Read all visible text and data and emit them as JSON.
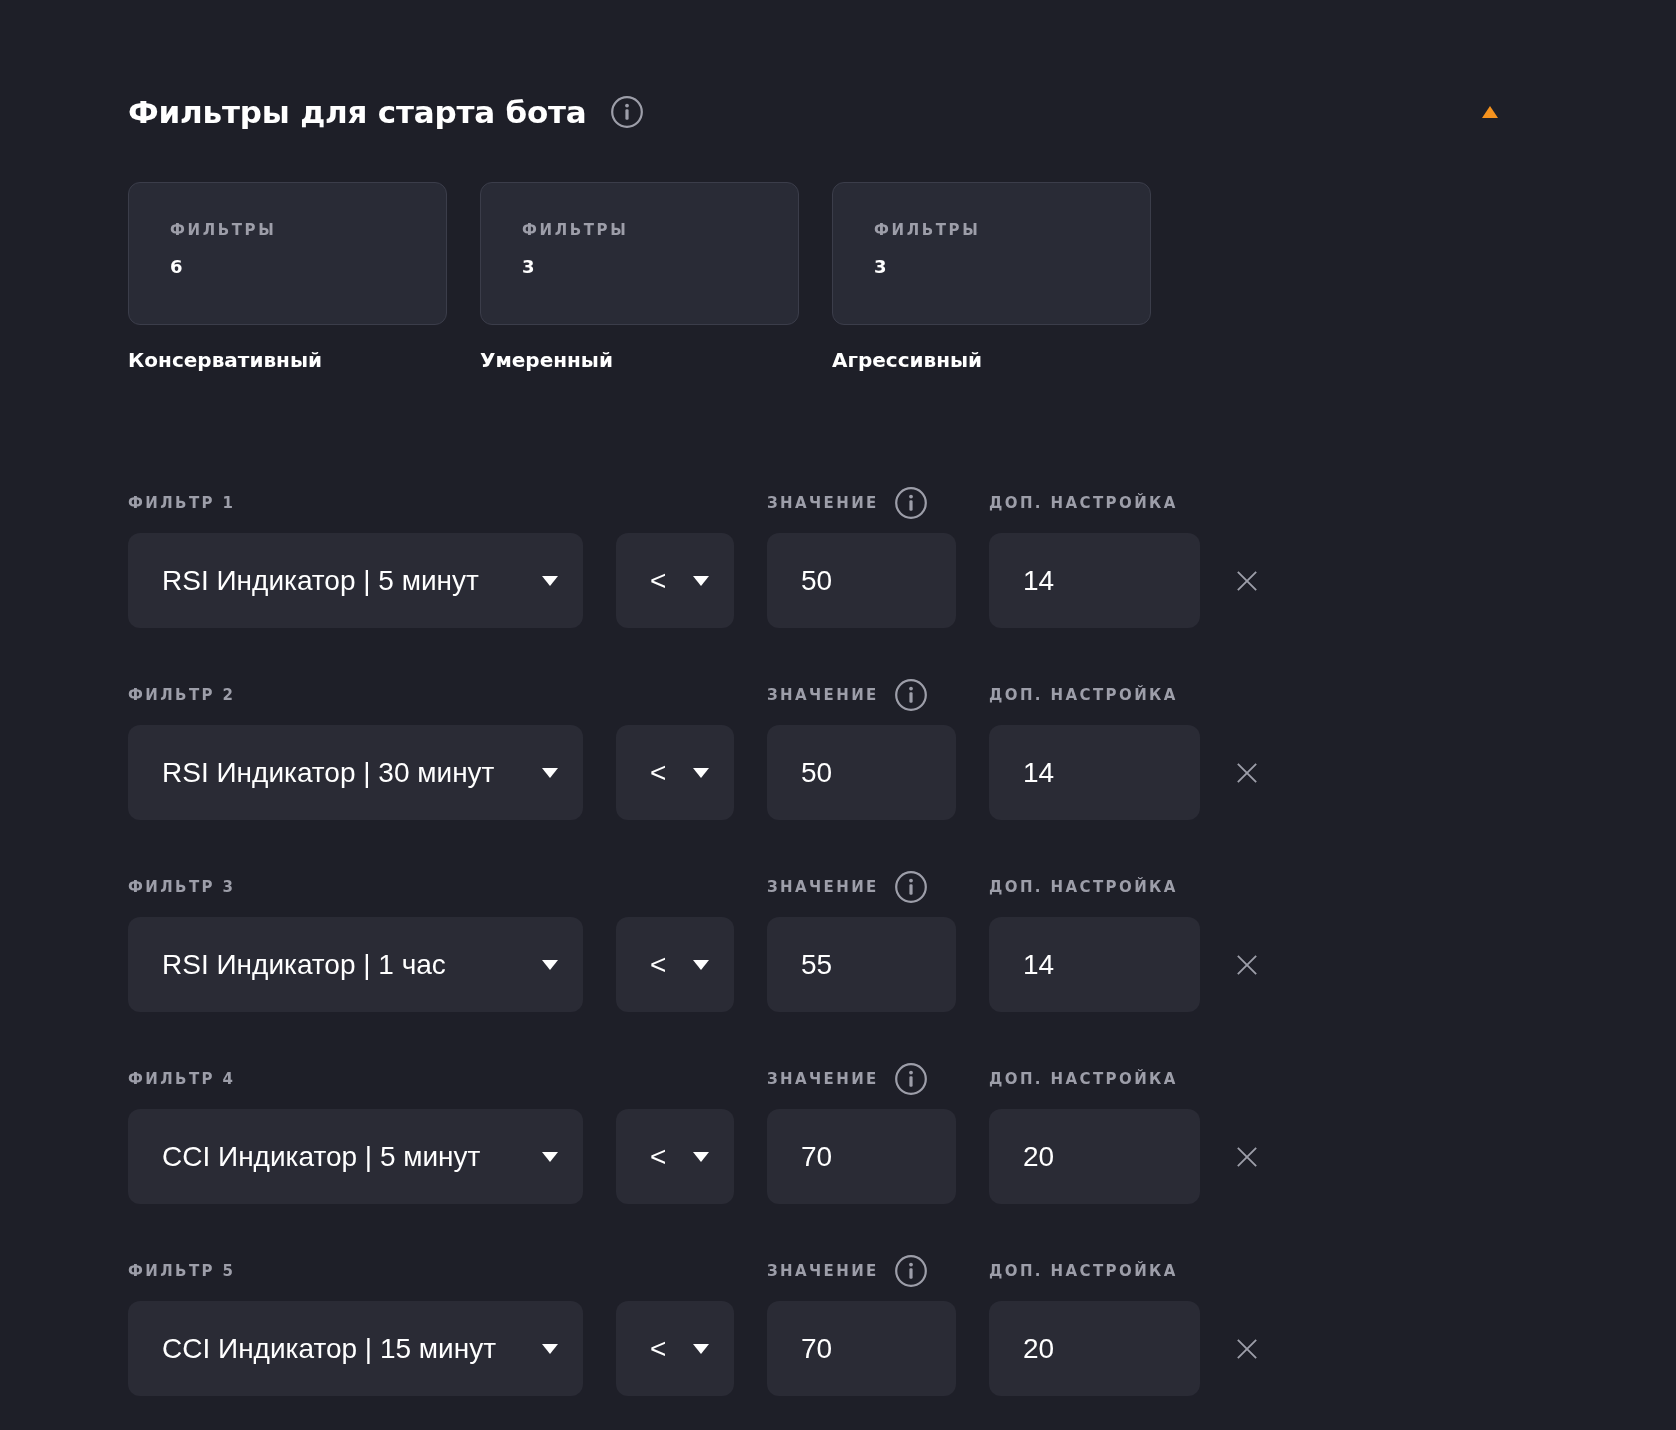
{
  "header": {
    "title": "Фильтры для старта бота",
    "expanded": true
  },
  "presets": [
    {
      "caption": "ФИЛЬТРЫ",
      "count": "6",
      "name": "Консервативный"
    },
    {
      "caption": "ФИЛЬТРЫ",
      "count": "3",
      "name": "Умеренный"
    },
    {
      "caption": "ФИЛЬТРЫ",
      "count": "3",
      "name": "Агрессивный"
    }
  ],
  "filters": [
    {
      "label": "ФИЛЬТР 1",
      "indicator": "RSI Индикатор | 5 минут",
      "operator": "<",
      "value_label": "ЗНАЧЕНИЕ",
      "value": "50",
      "extra_label": "ДОП. НАСТРОЙКА",
      "extra": "14"
    },
    {
      "label": "ФИЛЬТР 2",
      "indicator": "RSI Индикатор | 30 минут",
      "operator": "<",
      "value_label": "ЗНАЧЕНИЕ",
      "value": "50",
      "extra_label": "ДОП. НАСТРОЙКА",
      "extra": "14"
    },
    {
      "label": "ФИЛЬТР 3",
      "indicator": "RSI Индикатор | 1 час",
      "operator": "<",
      "value_label": "ЗНАЧЕНИЕ",
      "value": "55",
      "extra_label": "ДОП. НАСТРОЙКА",
      "extra": "14"
    },
    {
      "label": "ФИЛЬТР 4",
      "indicator": "CCI Индикатор | 5 минут",
      "operator": "<",
      "value_label": "ЗНАЧЕНИЕ",
      "value": "70",
      "extra_label": "ДОП. НАСТРОЙКА",
      "extra": "20"
    },
    {
      "label": "ФИЛЬТР 5",
      "indicator": "CCI Индикатор | 15 минут",
      "operator": "<",
      "value_label": "ЗНАЧЕНИЕ",
      "value": "70",
      "extra_label": "ДОП. НАСТРОЙКА",
      "extra": "20"
    }
  ]
}
